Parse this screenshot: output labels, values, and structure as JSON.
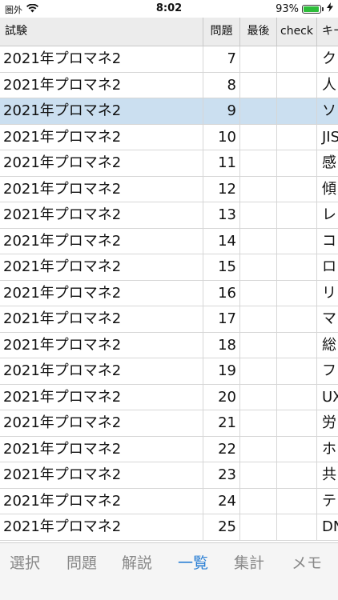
{
  "statusbar": {
    "carrier": "圏外",
    "time": "8:02",
    "battery": "93%",
    "battery_level": 0.93
  },
  "header": {
    "exam": "試験",
    "number": "問題",
    "last": "最後",
    "check": "check",
    "keyword": "キー"
  },
  "rows": [
    {
      "exam": "2021年プロマネ2",
      "number": "7",
      "keyword": "ク"
    },
    {
      "exam": "2021年プロマネ2",
      "number": "8",
      "keyword": "人"
    },
    {
      "exam": "2021年プロマネ2",
      "number": "9",
      "keyword": "ソ"
    },
    {
      "exam": "2021年プロマネ2",
      "number": "10",
      "keyword": "JIS"
    },
    {
      "exam": "2021年プロマネ2",
      "number": "11",
      "keyword": "感"
    },
    {
      "exam": "2021年プロマネ2",
      "number": "12",
      "keyword": "傾"
    },
    {
      "exam": "2021年プロマネ2",
      "number": "13",
      "keyword": "レ"
    },
    {
      "exam": "2021年プロマネ2",
      "number": "14",
      "keyword": "コ"
    },
    {
      "exam": "2021年プロマネ2",
      "number": "15",
      "keyword": "ロ"
    },
    {
      "exam": "2021年プロマネ2",
      "number": "16",
      "keyword": "リ"
    },
    {
      "exam": "2021年プロマネ2",
      "number": "17",
      "keyword": "マ"
    },
    {
      "exam": "2021年プロマネ2",
      "number": "18",
      "keyword": "総"
    },
    {
      "exam": "2021年プロマネ2",
      "number": "19",
      "keyword": "フ"
    },
    {
      "exam": "2021年プロマネ2",
      "number": "20",
      "keyword": "UX"
    },
    {
      "exam": "2021年プロマネ2",
      "number": "21",
      "keyword": "労"
    },
    {
      "exam": "2021年プロマネ2",
      "number": "22",
      "keyword": "ホ"
    },
    {
      "exam": "2021年プロマネ2",
      "number": "23",
      "keyword": "共"
    },
    {
      "exam": "2021年プロマネ2",
      "number": "24",
      "keyword": "テ"
    },
    {
      "exam": "2021年プロマネ2",
      "number": "25",
      "keyword": "DN"
    }
  ],
  "tabs": [
    {
      "label": "選択"
    },
    {
      "label": "問題"
    },
    {
      "label": "解説"
    },
    {
      "label": "一覧",
      "active": true
    },
    {
      "label": "集計"
    },
    {
      "label": "メモ"
    }
  ],
  "colors": {
    "selected_row": "#cbdff0",
    "active_tab": "#2a7fd4",
    "battery": "#2dbd3a"
  }
}
